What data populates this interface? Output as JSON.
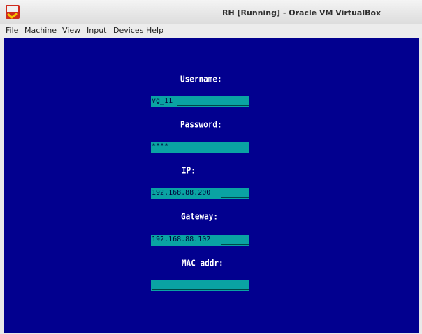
{
  "window": {
    "title": "RH [Running] - Oracle VM VirtualBox",
    "icon": "virtualbox-app-icon"
  },
  "menu": {
    "items": [
      "File",
      "Machine",
      "View",
      "Input",
      "Devices",
      "Help"
    ]
  },
  "colors": {
    "screen_background": "#02008f",
    "field_background": "#0aa3a3",
    "label_text": "#ffffff"
  },
  "form": {
    "username_label": "Username:",
    "username_value": "vg_11",
    "password_label": "Password:",
    "password_value": "****",
    "ip_label": "IP:",
    "ip_value": "192.168.88.200",
    "gateway_label": "Gateway:",
    "gateway_value": "192.168.88.102",
    "mac_label": "MAC addr:",
    "mac_value": ""
  }
}
